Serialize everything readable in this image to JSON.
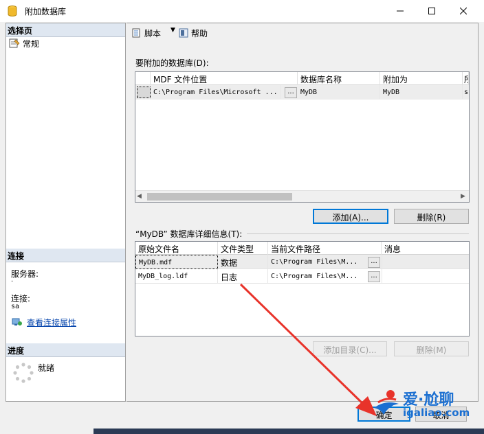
{
  "window": {
    "title": "附加数据库",
    "buttons": {
      "minimize": "—",
      "maximize": "☐",
      "close": "✕"
    }
  },
  "left": {
    "select_page_header": "选择页",
    "pages": [
      {
        "label": "常规"
      }
    ],
    "connection_header": "连接",
    "server_label": "服务器:",
    "server_value": ".",
    "connection_label": "连接:",
    "connection_value": "sa",
    "view_props_link": "查看连接属性",
    "progress_header": "进度",
    "progress_status": "就绪"
  },
  "toolbar": {
    "script_label": "脚本",
    "help_label": "帮助"
  },
  "attach_section": {
    "label": "要附加的数据库(D):",
    "columns": [
      "MDF 文件位置",
      "数据库名称",
      "附加为",
      "所"
    ],
    "rows": [
      {
        "mdf": "C:\\Program Files\\Microsoft ...",
        "name": "MyDB",
        "attach_as": "MyDB",
        "owner": "s"
      }
    ],
    "ellipsis": "...",
    "add_button": "添加(A)...",
    "remove_button": "删除(R)"
  },
  "details_section": {
    "label": "“MyDB” 数据库详细信息(T):",
    "columns": [
      "原始文件名",
      "文件类型",
      "当前文件路径",
      "消息"
    ],
    "rows": [
      {
        "file": "MyDB.mdf",
        "type": "数据",
        "path": "C:\\Program Files\\M...",
        "msg": ""
      },
      {
        "file": "MyDB_log.ldf",
        "type": "日志",
        "path": "C:\\Program Files\\M...",
        "msg": ""
      }
    ],
    "ellipsis": "...",
    "add_catalog_button": "添加目录(C)...",
    "remove_button": "删除(M)"
  },
  "footer": {
    "ok_button": "确定",
    "cancel_button": "取消"
  },
  "watermark": {
    "text": "爱·尬聊",
    "url": "igaliao.com"
  },
  "colors": {
    "annotation_arrow": "#e8332a",
    "accent": "#0078d7",
    "section_header_bg": "#dfe7f1"
  }
}
